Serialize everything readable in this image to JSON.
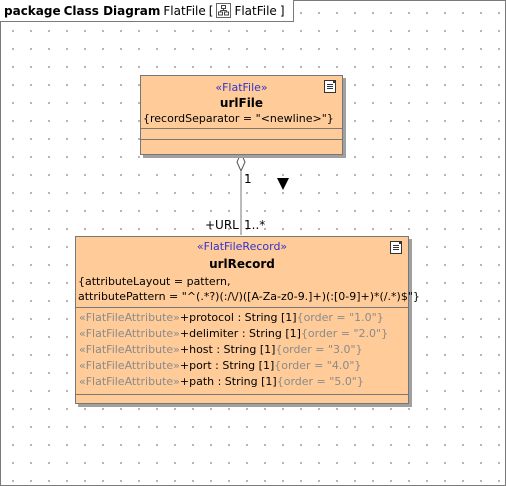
{
  "frame": {
    "keyword": "package",
    "title": "Class Diagram",
    "diagram_name": "FlatFile",
    "open_bracket": "[",
    "owner_name": "FlatFile",
    "close_bracket": "]"
  },
  "classes": {
    "urlFile": {
      "stereotype": "«FlatFile»",
      "name": "urlFile",
      "tagged_value": "{recordSeparator = \"<newline>\"}"
    },
    "urlRecord": {
      "stereotype": "«FlatFileRecord»",
      "name": "urlRecord",
      "tagged_line1": "{attributeLayout = pattern,",
      "tagged_line2": "attributePattern = \"^(.*?)(:/\\/)([A-Za-z0-9.]+)(:[0-9]+)*(/.*)$\"}",
      "attributes": [
        {
          "stereotype": "«FlatFileAttribute»",
          "text": "+protocol : String [1]",
          "tag": "{order = \"1.0\"}"
        },
        {
          "stereotype": "«FlatFileAttribute»",
          "text": "+delimiter : String [1]",
          "tag": "{order = \"2.0\"}"
        },
        {
          "stereotype": "«FlatFileAttribute»",
          "text": "+host : String [1]",
          "tag": "{order = \"3.0\"}"
        },
        {
          "stereotype": "«FlatFileAttribute»",
          "text": "+port : String [1]",
          "tag": "{order = \"4.0\"}"
        },
        {
          "stereotype": "«FlatFileAttribute»",
          "text": "+path : String [1]",
          "tag": "{order = \"5.0\"}"
        }
      ]
    }
  },
  "association": {
    "source_multiplicity": "1",
    "target_role": "+URL",
    "target_multiplicity": "1..*"
  },
  "colors": {
    "class_fill": "#ffcc99",
    "stereotype_text": "#3333cc",
    "attribute_stereotype_text": "#8a8a8a"
  }
}
